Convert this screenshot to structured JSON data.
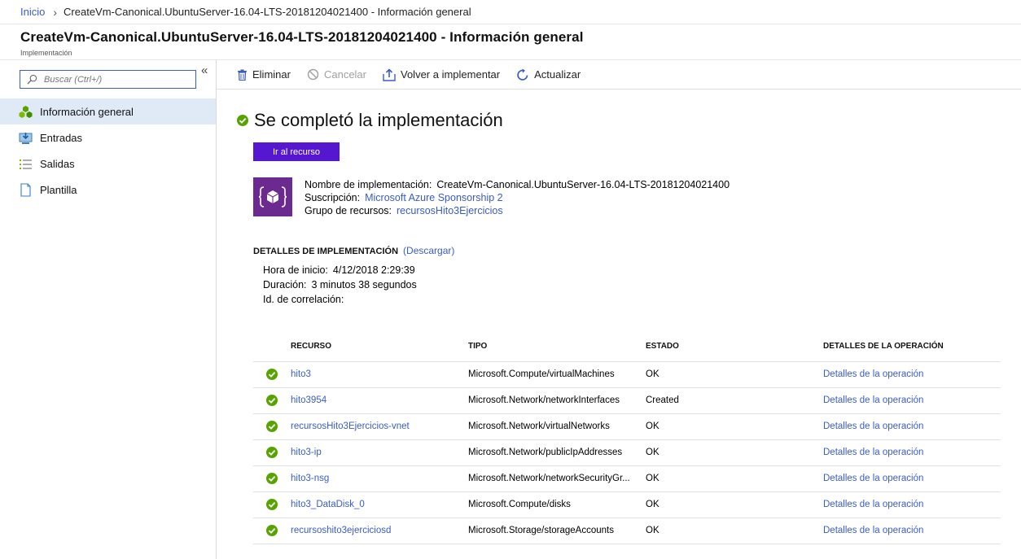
{
  "breadcrumb": {
    "home": "Inicio",
    "current": "CreateVm-Canonical.UbuntuServer-16.04-LTS-20181204021400 - Información general"
  },
  "header": {
    "title": "CreateVm-Canonical.UbuntuServer-16.04-LTS-20181204021400 - Información general",
    "subtitle": "Implementación"
  },
  "sidebar": {
    "search_placeholder": "Buscar (Ctrl+/)",
    "collapse": "«",
    "items": [
      {
        "label": "Información general",
        "icon": "overview-icon",
        "active": true
      },
      {
        "label": "Entradas",
        "icon": "inputs-icon"
      },
      {
        "label": "Salidas",
        "icon": "outputs-icon"
      },
      {
        "label": "Plantilla",
        "icon": "template-icon"
      }
    ]
  },
  "toolbar": {
    "delete": "Eliminar",
    "cancel": "Cancelar",
    "redeploy": "Volver a implementar",
    "refresh": "Actualizar"
  },
  "main": {
    "status": "Se completó la implementación",
    "go_button": "Ir al recurso",
    "deployment_name_label": "Nombre de implementación:",
    "deployment_name": "CreateVm-Canonical.UbuntuServer-16.04-LTS-20181204021400",
    "subscription_label": "Suscripción:",
    "subscription": "Microsoft Azure Sponsorship 2",
    "resource_group_label": "Grupo de recursos:",
    "resource_group": "recursosHito3Ejercicios",
    "details_header": "DETALLES DE IMPLEMENTACIÓN",
    "download": "(Descargar)",
    "start_time_label": "Hora de inicio:",
    "start_time": "4/12/2018 2:29:39",
    "duration_label": "Duración:",
    "duration": "3 minutos 38 segundos",
    "correlation_label": "Id. de correlación:"
  },
  "table": {
    "columns": [
      "RECURSO",
      "TIPO",
      "ESTADO",
      "DETALLES DE LA OPERACIÓN"
    ],
    "rows": [
      {
        "resource": "hito3",
        "type": "Microsoft.Compute/virtualMachines",
        "status": "OK",
        "details": "Detalles de la operación"
      },
      {
        "resource": "hito3954",
        "type": "Microsoft.Network/networkInterfaces",
        "status": "Created",
        "details": "Detalles de la operación"
      },
      {
        "resource": "recursosHito3Ejercicios-vnet",
        "type": "Microsoft.Network/virtualNetworks",
        "status": "OK",
        "details": "Detalles de la operación"
      },
      {
        "resource": "hito3-ip",
        "type": "Microsoft.Network/publicIpAddresses",
        "status": "OK",
        "details": "Detalles de la operación"
      },
      {
        "resource": "hito3-nsg",
        "type": "Microsoft.Network/networkSecurityGr...",
        "status": "OK",
        "details": "Detalles de la operación"
      },
      {
        "resource": "hito3_DataDisk_0",
        "type": "Microsoft.Compute/disks",
        "status": "OK",
        "details": "Detalles de la operación"
      },
      {
        "resource": "recursoshito3ejerciciosd",
        "type": "Microsoft.Storage/storageAccounts",
        "status": "OK",
        "details": "Detalles de la operación"
      }
    ]
  },
  "colors": {
    "link": "#3a5bc7",
    "primary_button": "#5617d0",
    "success": "#57a300",
    "resource_icon_bg": "#6b2a8f",
    "active_nav_bg": "#dfeaf6"
  }
}
